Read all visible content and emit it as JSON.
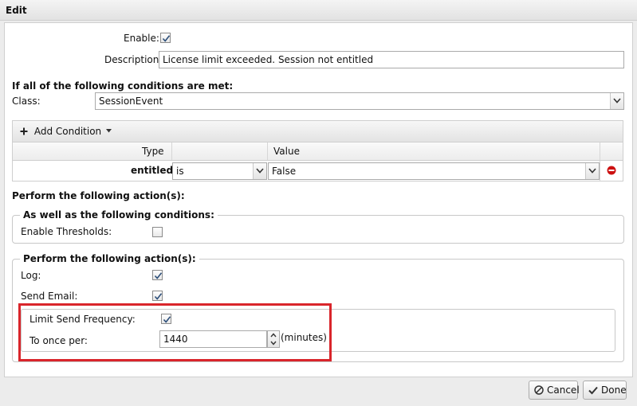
{
  "dialog": {
    "title": "Edit",
    "cancel_label": "Cancel",
    "done_label": "Done"
  },
  "form": {
    "enable_label": "Enable:",
    "enable_checked": true,
    "description_label": "Description:",
    "description_value": "License limit exceeded. Session not entitled",
    "conditions_heading": "If all of the following conditions are met:",
    "class_label": "Class:",
    "class_value": "SessionEvent"
  },
  "conditions_grid": {
    "add_condition_label": "Add Condition",
    "columns": [
      "Type",
      "Value"
    ],
    "rows": [
      {
        "type": "entitled:",
        "operator": "is",
        "value": "False"
      }
    ]
  },
  "actions": {
    "heading": "Perform the following action(s):",
    "thresholds_group": {
      "legend": "As well as the following conditions:",
      "enable_thresholds_label": "Enable Thresholds:",
      "enable_thresholds_checked": false
    },
    "actions_group": {
      "legend": "Perform the following action(s):",
      "log_label": "Log:",
      "log_checked": true,
      "send_email_label": "Send Email:",
      "send_email_checked": true,
      "limit_frequency_label": "Limit Send Frequency:",
      "limit_frequency_checked": true,
      "once_per_label": "To once per:",
      "once_per_value": "1440",
      "once_per_unit": "(minutes)"
    }
  },
  "colors": {
    "highlight": "#d9252b",
    "remove_icon": "#cc1111"
  }
}
